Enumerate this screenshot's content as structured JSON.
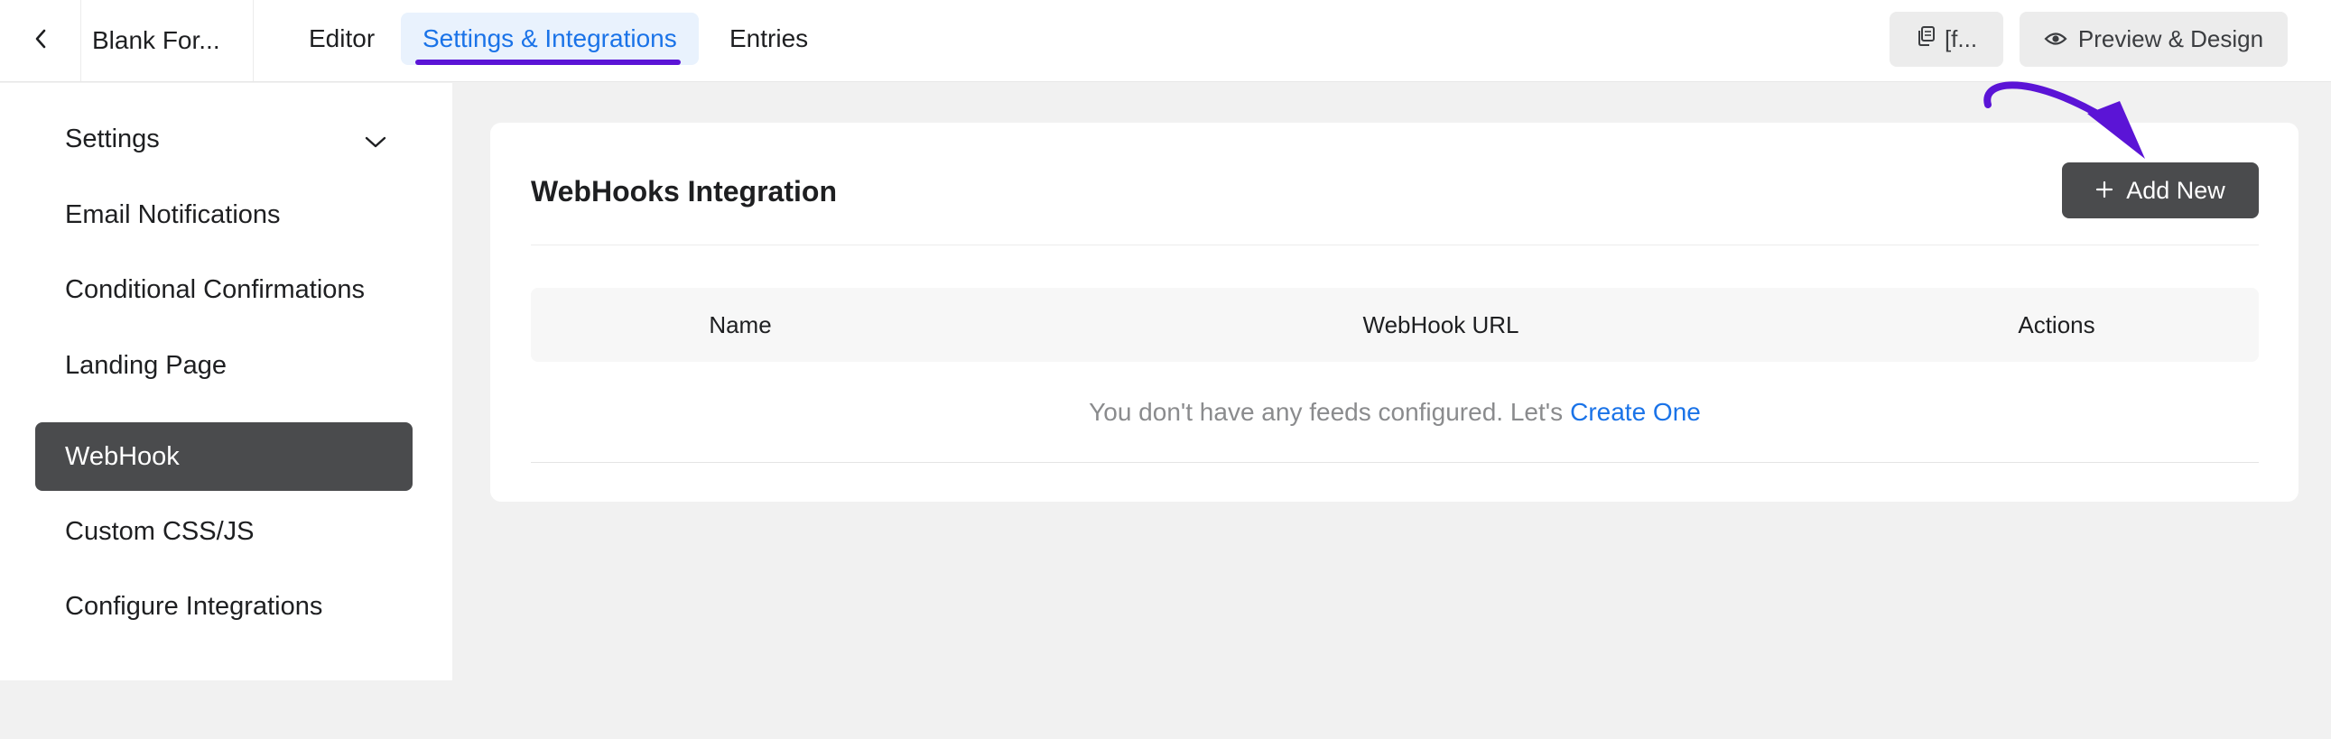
{
  "header": {
    "form_title": "Blank For...",
    "tabs": [
      {
        "label": "Editor"
      },
      {
        "label": "Settings & Integrations",
        "active": true
      },
      {
        "label": "Entries"
      }
    ],
    "shortcode_label": "[f...",
    "preview_label": "Preview & Design"
  },
  "sidebar": {
    "items": [
      {
        "label": "Settings",
        "expandable": true
      },
      {
        "label": "Email Notifications"
      },
      {
        "label": "Conditional Confirmations"
      },
      {
        "label": "Landing Page"
      },
      {
        "label": "WebHook",
        "active": true
      },
      {
        "label": "Custom CSS/JS"
      },
      {
        "label": "Configure Integrations"
      }
    ]
  },
  "main": {
    "title": "WebHooks Integration",
    "add_button_label": "Add New",
    "table": {
      "columns": [
        "Name",
        "WebHook URL",
        "Actions"
      ],
      "empty_text": "You don't have any feeds configured. Let's",
      "empty_link": "Create One"
    }
  },
  "colors": {
    "accent_blue": "#1a73e8",
    "active_tab_bg": "#e9f2fd",
    "tab_underline": "#5b14d6",
    "dark_button": "#4a4b4d",
    "annotation_arrow": "#5b14d6"
  }
}
